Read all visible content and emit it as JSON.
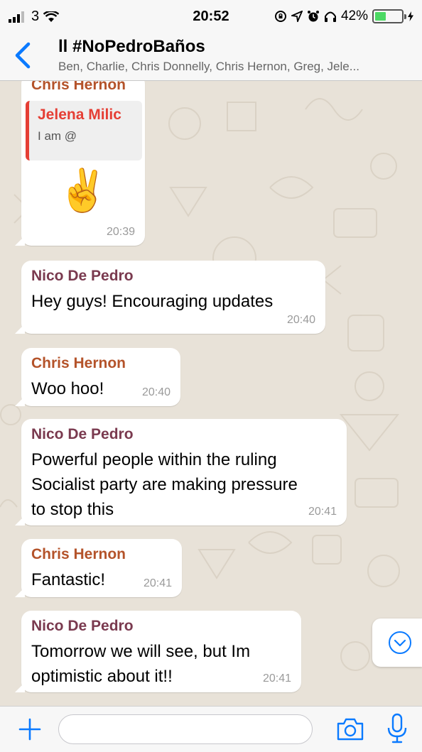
{
  "status_bar": {
    "carrier": "3",
    "time": "20:52",
    "battery_percent": "42%",
    "battery_level": 0.42
  },
  "header": {
    "title": "ll #NoPedroBaños",
    "participants": "Ben, Charlie, Chris Donnelly, Chris Hernon, Greg, Jele..."
  },
  "messages": [
    {
      "sender": "Chris Hernon",
      "quote": {
        "sender": "Jelena Milic",
        "text": "I am @"
      },
      "text": "✌️",
      "time": "20:39"
    },
    {
      "sender": "Nico De Pedro",
      "text": "Hey guys! Encouraging updates",
      "time": "20:40"
    },
    {
      "sender": "Chris Hernon",
      "text": "Woo hoo!",
      "time": "20:40"
    },
    {
      "sender": "Nico De Pedro",
      "lines": [
        "Powerful people within the ruling",
        "Socialist party are making pressure",
        "to stop this"
      ],
      "time": "20:41"
    },
    {
      "sender": "Chris Hernon",
      "text": "Fantastic!",
      "time": "20:41"
    },
    {
      "sender": "Nico De Pedro",
      "lines": [
        "Tomorrow we will see, but Im",
        "optimistic about it!!"
      ],
      "time": "20:41"
    }
  ],
  "input": {
    "placeholder": ""
  },
  "colors": {
    "accent": "#0a7aff",
    "chris_name": "#b4532a",
    "nico_name": "#7a3a4f",
    "quote_bar": "#e53e34",
    "chat_bg": "#e8e2d8"
  }
}
